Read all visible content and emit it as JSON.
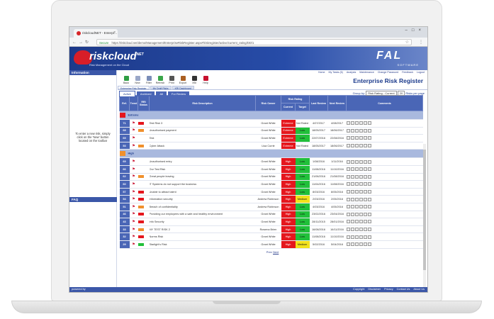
{
  "browser": {
    "tab_title": "riskcloudNET - Enterpr...",
    "url_secure": "Secure",
    "url": "https://riskcloud.net/demo/Management/EnterpriseRiskRegister.aspx#/riskregister/active/current_rating/DD/1"
  },
  "header": {
    "logo_text": "riskcloud",
    "logo_sup": "NET",
    "logo_sub": "Risk Management on the Cloud",
    "brand": "FAL",
    "brand_sub": "SOFTWARE"
  },
  "sidebar": {
    "info_title": "Information",
    "info_text": "To enter a new risk, simply click on the 'New' button located on the toolbar",
    "faq_title": "FAQ"
  },
  "toplinks": [
    "Home",
    "My Tasks (6)",
    "Analysis",
    "Maintenance",
    "Change Password",
    "Feedback",
    "Logout"
  ],
  "toolbar": {
    "tools": [
      "Back",
      "New",
      "Filter",
      "Refresh",
      "Print",
      "Export",
      "XBI",
      "Help"
    ],
    "page_title": "Enterprise Risk Register"
  },
  "subtabs": [
    "Enterprise Risk Register",
    "My Draft Risks",
    "KRI Dashboard"
  ],
  "filters": {
    "tabs": [
      "Active",
      "Archived",
      "All",
      "For Review"
    ],
    "group_label": "Group by:",
    "group_value": "Risk Rating - Current",
    "page_size": "20",
    "page_size_label": "Risks per page"
  },
  "table": {
    "headers": [
      "Ref.",
      "Trend",
      "RRI Status",
      "Risk Description",
      "Risk Owner",
      "Risk Rating",
      "Last Review",
      "Next Review",
      "Comments"
    ],
    "rating_sub": [
      "Current",
      "Target"
    ],
    "groups": [
      {
        "name": "Extreme",
        "color": "#e5161d",
        "rows": [
          {
            "ref": "71",
            "status": "#e5161d",
            "desc": "Test Risk 3",
            "owner": "Grant White",
            "current": "Extreme",
            "cur_c": "red",
            "target": "Not Rated",
            "tgt_c": "none",
            "last": "4/07/2017",
            "next": "4/08/2017"
          },
          {
            "ref": "68",
            "status": "#f0902c",
            "desc": "Unauthorised payment",
            "owner": "Grant White",
            "current": "Extreme",
            "cur_c": "red",
            "target": "Low",
            "tgt_c": "green",
            "last": "18/05/2017",
            "next": "18/06/2017"
          },
          {
            "ref": "65",
            "status": "",
            "desc": "Test",
            "owner": "Grant White",
            "current": "Extreme",
            "cur_c": "red",
            "target": "Low",
            "tgt_c": "green",
            "last": "22/07/2016",
            "next": "22/08/2016"
          },
          {
            "ref": "53",
            "status": "#f0902c",
            "desc": "Cyber Attack",
            "owner": "Lisa Currie",
            "current": "Extreme",
            "cur_c": "red",
            "target": "Not Rated",
            "tgt_c": "none",
            "last": "18/05/2017",
            "next": "18/06/2017"
          }
        ]
      },
      {
        "name": "High",
        "color": "#f0902c",
        "rows": [
          {
            "ref": "69",
            "status": "",
            "desc": "Unauthorised entry",
            "owner": "Grant White",
            "current": "High",
            "cur_c": "red",
            "target": "Low",
            "tgt_c": "green",
            "last": "1/08/2016",
            "next": "1/11/2016"
          },
          {
            "ref": "66",
            "status": "",
            "desc": "Our Test Risk",
            "owner": "Grant White",
            "current": "High",
            "cur_c": "red",
            "target": "Low",
            "tgt_c": "green",
            "last": "11/08/2016",
            "next": "11/10/2016"
          },
          {
            "ref": "62",
            "status": "#f0902c",
            "desc": "Great people leaving",
            "owner": "Grant White",
            "current": "High",
            "cur_c": "red",
            "target": "Low",
            "tgt_c": "green",
            "last": "21/06/2016",
            "next": "21/08/2016"
          },
          {
            "ref": "60",
            "status": "",
            "desc": "IT Systems do not support the business",
            "owner": "Grant White",
            "current": "High",
            "cur_c": "red",
            "target": "Low",
            "tgt_c": "green",
            "last": "11/04/2016",
            "next": "11/08/2016"
          },
          {
            "ref": "57",
            "status": "#e5161d",
            "desc": "Unable to attract talent",
            "owner": "Grant White",
            "current": "High",
            "cur_c": "red",
            "target": "Low",
            "tgt_c": "green",
            "last": "8/03/2016",
            "next": "8/05/2016"
          },
          {
            "ref": "54",
            "status": "#e5161d",
            "desc": "Information security",
            "owner": "Andrew Robinson",
            "current": "High",
            "cur_c": "red",
            "target": "Medium",
            "tgt_c": "yellow",
            "last": "2/03/2016",
            "next": "2/05/2016"
          },
          {
            "ref": "51",
            "status": "#f0902c",
            "desc": "Breach of confidentiality",
            "owner": "Andrew Robinson",
            "current": "High",
            "cur_c": "red",
            "target": "Low",
            "tgt_c": "green",
            "last": "4/03/2016",
            "next": "4/05/2016"
          },
          {
            "ref": "46",
            "status": "#e5161d",
            "desc": "Providing our employees with a safe and healthy environment",
            "owner": "Grant White",
            "current": "High",
            "cur_c": "red",
            "target": "Low",
            "tgt_c": "green",
            "last": "23/02/2016",
            "next": "23/04/2016"
          },
          {
            "ref": "43",
            "status": "#e5161d",
            "desc": "Info Security",
            "owner": "Grant White",
            "current": "High",
            "cur_c": "red",
            "target": "Low",
            "tgt_c": "green",
            "last": "28/11/2015",
            "next": "28/01/2016"
          },
          {
            "ref": "33",
            "status": "#f0902c",
            "desc": "MY TEST RISK 2",
            "owner": "Rowena Brien",
            "current": "High",
            "cur_c": "red",
            "target": "Low",
            "tgt_c": "green",
            "last": "16/08/2016",
            "next": "16/11/2016"
          },
          {
            "ref": "32",
            "status": "#e5161d",
            "desc": "Norms Risk",
            "owner": "Grant White",
            "current": "High",
            "cur_c": "red",
            "target": "Low",
            "tgt_c": "green",
            "last": "11/08/2016",
            "next": "11/10/2016"
          },
          {
            "ref": "29",
            "status": "#21c03a",
            "desc": "Starlight's Risk",
            "owner": "Grant White",
            "current": "High",
            "cur_c": "red",
            "target": "Medium",
            "tgt_c": "yellow",
            "last": "5/02/2016",
            "next": "5/04/2016"
          }
        ]
      }
    ]
  },
  "pager": {
    "prev": "Prev",
    "next": "Next"
  },
  "footer": {
    "powered": "powered by",
    "links": [
      "Copyright",
      "Disclaimer",
      "Privacy",
      "Contact Us",
      "About Us"
    ]
  }
}
